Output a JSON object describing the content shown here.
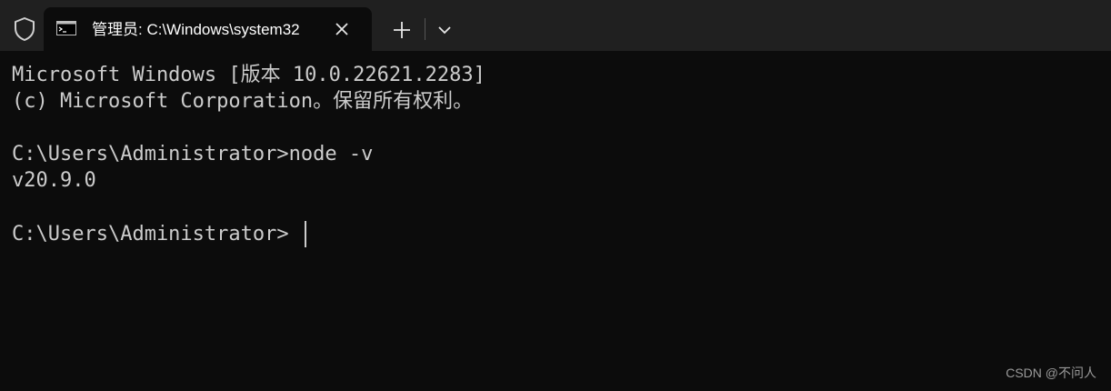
{
  "tab": {
    "title": "管理员: C:\\Windows\\system32",
    "icon": "cmd-icon"
  },
  "toolbar": {
    "shield_icon": "shield-icon",
    "new_tab_icon": "plus-icon",
    "dropdown_icon": "chevron-down-icon",
    "close_icon": "close-icon"
  },
  "console": {
    "lines": [
      "Microsoft Windows [版本 10.0.22621.2283]",
      "(c) Microsoft Corporation。保留所有权利。",
      "",
      "C:\\Users\\Administrator>node -v",
      "v20.9.0",
      "",
      "C:\\Users\\Administrator>"
    ]
  },
  "watermark": "CSDN @不问人",
  "colors": {
    "titlebar": "#202020",
    "background": "#0c0c0c",
    "text": "#cccccc"
  }
}
